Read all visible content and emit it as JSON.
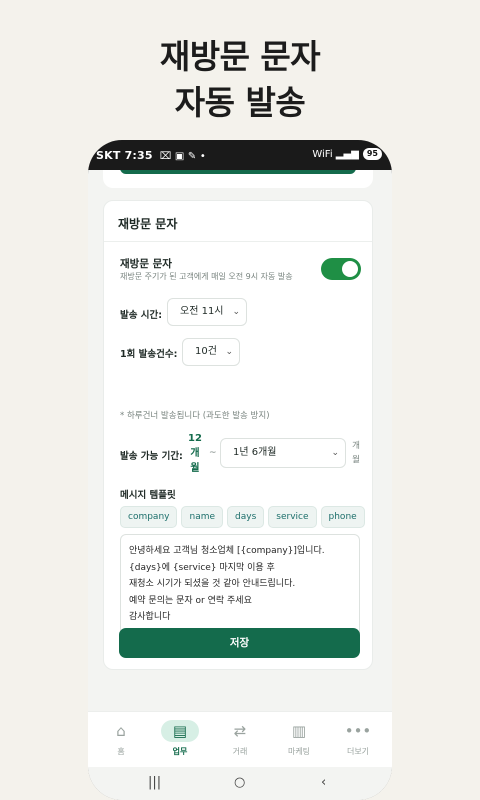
{
  "headline": {
    "line1": "재방문 문자",
    "line2": "자동 발송"
  },
  "status_bar": {
    "carrier_time": "SKT 7:35",
    "icons": "⌧ ▣ ✎ •",
    "signal": "WiFi ▂▄▆",
    "battery": "95"
  },
  "card": {
    "title": "재방문 문자",
    "toggle_row": {
      "title": "재방문 문자",
      "description": "재방문 주기가 된 고객에게 매일 오전 9시 자동 발송",
      "enabled": true
    },
    "send_time": {
      "label": "발송 시간:",
      "value": "오전 11시"
    },
    "send_count": {
      "label": "1회 발송건수:",
      "value": "10건"
    },
    "note": "* 하루건너 발송됩니다 (과도한 발송 방지)",
    "period": {
      "label": "발송 가능 기간:",
      "from_lines": [
        "12",
        "개",
        "월"
      ],
      "separator": "~",
      "to": "1년 6개월",
      "unit_lines": [
        "개",
        "월"
      ]
    },
    "template": {
      "label": "메시지 템플릿",
      "variables": [
        "company",
        "name",
        "days",
        "service",
        "phone"
      ],
      "lines": [
        "안녕하세요 고객님 청소업체 [{company}]입니다.",
        "{days}에 {service} 마지막 이용 후",
        "재청소 시기가 되셨을 것 같아 안내드립니다.",
        "예약 문의는 문자 or 연락 주세요",
        "감사합니다"
      ]
    },
    "save_label": "저장"
  },
  "bottom_nav": [
    {
      "label": "홈",
      "icon": "home-icon",
      "glyph": "⌂"
    },
    {
      "label": "업무",
      "icon": "clipboard-icon",
      "glyph": "▤",
      "active": true
    },
    {
      "label": "거래",
      "icon": "transfer-icon",
      "glyph": "⇄"
    },
    {
      "label": "마케팅",
      "icon": "bar-chart-icon",
      "glyph": "▥"
    },
    {
      "label": "더보기",
      "icon": "more-icon",
      "glyph": "•••"
    }
  ],
  "system_nav": {
    "recents": "|||",
    "home": "○",
    "back": "‹"
  },
  "colors": {
    "accent": "#146b4c",
    "toggle_on": "#1f8f45",
    "chip_text": "#1d6f6b",
    "background": "#f4f2ec"
  }
}
